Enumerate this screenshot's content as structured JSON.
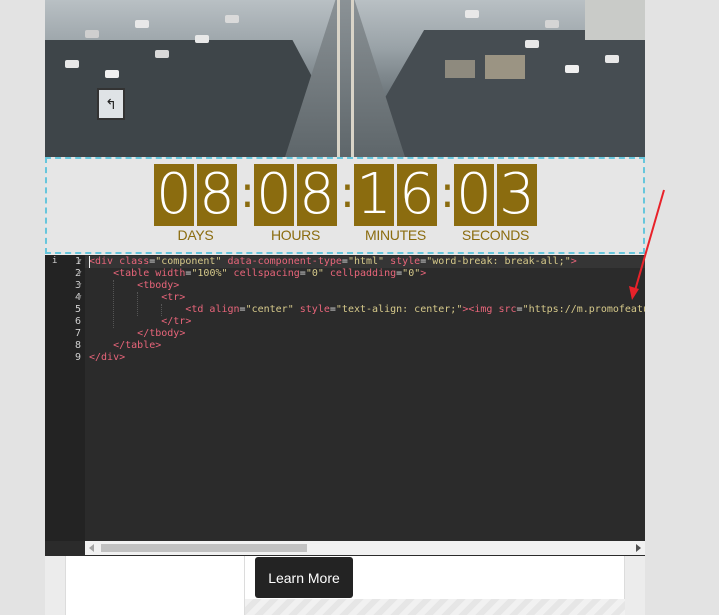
{
  "countdown": {
    "days": [
      "0",
      "8"
    ],
    "hours": [
      "0",
      "8"
    ],
    "minutes": [
      "1",
      "6"
    ],
    "seconds": [
      "0",
      "3"
    ],
    "separator": ":",
    "labels": {
      "days": "DAYS",
      "hours": "HOURS",
      "minutes": "MINUTES",
      "seconds": "SECONDS"
    },
    "color": "#8b6c0f"
  },
  "editor": {
    "active_marker": "i",
    "line_numbers": [
      "1",
      "2",
      "3",
      "4",
      "5",
      "6",
      "7",
      "8",
      "9"
    ],
    "lines": [
      [
        [
          "tag",
          "<div "
        ],
        [
          "attr",
          "class"
        ],
        [
          "eq",
          "="
        ],
        [
          "str",
          "\"component\""
        ],
        [
          "eq",
          " "
        ],
        [
          "attr",
          "data-component-type"
        ],
        [
          "eq",
          "="
        ],
        [
          "str",
          "\"html\""
        ],
        [
          "eq",
          " "
        ],
        [
          "attr",
          "style"
        ],
        [
          "eq",
          "="
        ],
        [
          "str",
          "\"word-break: break-all;\""
        ],
        [
          "tag",
          ">"
        ]
      ],
      [
        [
          "eq",
          "    "
        ],
        [
          "tag",
          "<table "
        ],
        [
          "attr",
          "width"
        ],
        [
          "eq",
          "="
        ],
        [
          "str",
          "\"100%\""
        ],
        [
          "eq",
          " "
        ],
        [
          "attr",
          "cellspacing"
        ],
        [
          "eq",
          "="
        ],
        [
          "str",
          "\"0\""
        ],
        [
          "eq",
          " "
        ],
        [
          "attr",
          "cellpadding"
        ],
        [
          "eq",
          "="
        ],
        [
          "str",
          "\"0\""
        ],
        [
          "tag",
          ">"
        ]
      ],
      [
        [
          "eq",
          "        "
        ],
        [
          "tag",
          "<tbody>"
        ]
      ],
      [
        [
          "eq",
          "            "
        ],
        [
          "tag",
          "<tr>"
        ]
      ],
      [
        [
          "eq",
          "                "
        ],
        [
          "tag",
          "<td "
        ],
        [
          "attr",
          "align"
        ],
        [
          "eq",
          "="
        ],
        [
          "str",
          "\"center\""
        ],
        [
          "eq",
          " "
        ],
        [
          "attr",
          "style"
        ],
        [
          "eq",
          "="
        ],
        [
          "str",
          "\"text-align: center;\""
        ],
        [
          "tag",
          "><img "
        ],
        [
          "attr",
          "src"
        ],
        [
          "eq",
          "="
        ],
        [
          "str",
          "\"https://m.promofeatu"
        ]
      ],
      [
        [
          "eq",
          "            "
        ],
        [
          "tag",
          "</tr>"
        ]
      ],
      [
        [
          "eq",
          "        "
        ],
        [
          "tag",
          "</tbody>"
        ]
      ],
      [
        [
          "eq",
          "    "
        ],
        [
          "tag",
          "</table>"
        ]
      ],
      [
        [
          "tag",
          "</div>"
        ]
      ]
    ]
  },
  "content": {
    "learn_more_label": "Learn More"
  },
  "colors": {
    "annotation_arrow": "#e8222a",
    "selection_border": "#67c6dc",
    "button_bg": "#232323"
  }
}
